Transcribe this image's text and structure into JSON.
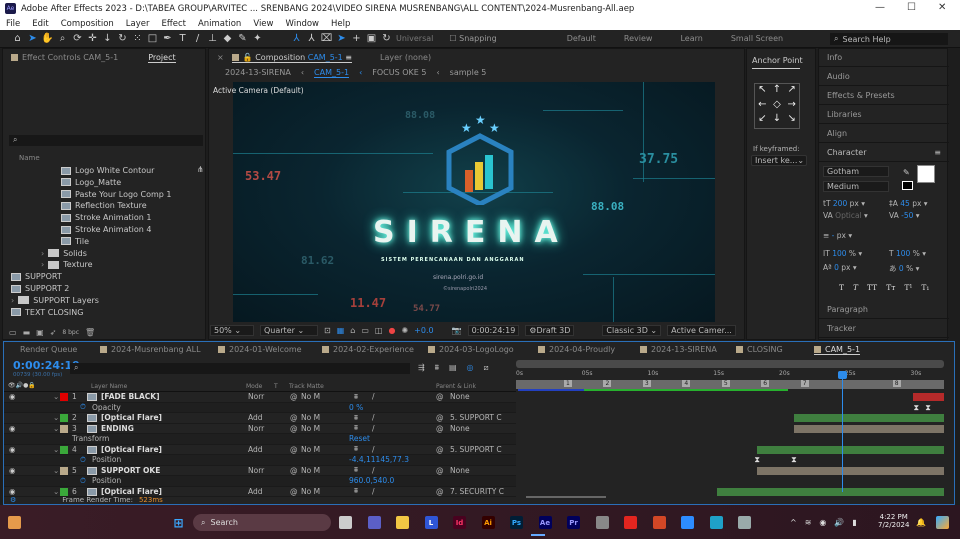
{
  "window": {
    "title": "Adobe After Effects 2023 - D:\\TABEA GROUP\\ARVITEC ... SRENBANG 2024\\VIDEO SIRENA MUSRENBANG\\ALL CONTENT\\2024-Musrenbang-All.aep",
    "app_badge": "Ae"
  },
  "menu": [
    "File",
    "Edit",
    "Composition",
    "Layer",
    "Effect",
    "Animation",
    "View",
    "Window",
    "Help"
  ],
  "toolbar": {
    "universal": "Universal",
    "snapping": "Snapping",
    "workspaces": [
      "Default",
      "Review",
      "Learn",
      "Small Screen"
    ],
    "search_placeholder": "Search Help"
  },
  "left_panel": {
    "tabs": [
      "Effect Controls CAM_5-1",
      "Project"
    ],
    "name_header": "Name",
    "items": [
      {
        "label": "Logo White Contour",
        "type": "comp"
      },
      {
        "label": "Logo_Matte",
        "type": "comp"
      },
      {
        "label": "Paste Your Logo Comp 1",
        "type": "comp"
      },
      {
        "label": "Reflection Texture",
        "type": "comp"
      },
      {
        "label": "Stroke Animation 1",
        "type": "comp"
      },
      {
        "label": "Stroke Animation 4",
        "type": "comp"
      },
      {
        "label": "Tile",
        "type": "comp"
      },
      {
        "label": "Solids",
        "type": "folder"
      },
      {
        "label": "Texture",
        "type": "folder"
      },
      {
        "label": "SUPPORT",
        "type": "comp"
      },
      {
        "label": "SUPPORT 2",
        "type": "comp"
      },
      {
        "label": "SUPPORT Layers",
        "type": "folder"
      },
      {
        "label": "TEXT CLOSING",
        "type": "comp"
      }
    ],
    "bpc": "8 bpc"
  },
  "composition": {
    "tab_prefix": "Composition",
    "tab_name": "CAM_5-1",
    "layer_tab": "Layer  (none)",
    "breadcrumbs": [
      "2024-13-SIRENA",
      "CAM_5-1",
      "FOCUS OKE 5",
      "sample 5"
    ],
    "camera_label": "Active Camera (Default)",
    "viewer": {
      "title": "SIRENA",
      "subtitle": "SISTEM PERENCANAAN DAN ANGGARAN",
      "url": "sirena.polri.go.id",
      "copyright": "©sirenapolri2024",
      "numbers": [
        "53.47",
        "37.75",
        "88.08",
        "81.62",
        "11.47",
        "54.77",
        "88.08"
      ]
    },
    "bottom_bar": {
      "zoom": "50%",
      "resolution": "Quarter",
      "exposure": "+0.0",
      "timecode": "0:00:24:19",
      "draft": "Draft 3D",
      "renderer": "Classic 3D",
      "view": "Active Camer..."
    }
  },
  "anchor_panel": {
    "title": "Anchor Point",
    "if_keyframed": "If keyframed:",
    "mode": "Insert ke..."
  },
  "right_panel": {
    "items": [
      "Info",
      "Audio",
      "Effects & Presets",
      "Libraries",
      "Align"
    ],
    "character": {
      "title": "Character",
      "font": "Gotham",
      "style": "Medium",
      "size": "200",
      "size_unit": "px",
      "leading": "45",
      "leading_unit": "px",
      "kerning": "Optical",
      "tracking": "-50",
      "stroke": "-",
      "stroke_unit": "px",
      "vscale": "100",
      "hscale": "100",
      "pct": "%",
      "baseline": "0",
      "baseline_unit": "px",
      "tsume": "0",
      "fill_color": "#ffffff",
      "styles": [
        "T",
        "T",
        "TT",
        "Tт",
        "T¹",
        "T₁"
      ]
    },
    "bottom": [
      "Paragraph",
      "Tracker"
    ]
  },
  "timeline": {
    "tabs": [
      "Render Queue",
      "2024-Musrenbang ALL",
      "2024-01-Welcome",
      "2024-02-Experience",
      "2024-03-LogoLogo",
      "2024-04-Proudly",
      "2024-13-SIRENA",
      "CLOSING",
      "CAM_5-1"
    ],
    "current_time": "0:00:24:19",
    "frame_info": "00739 (30.00 fps)",
    "headers": {
      "layer_name": "Layer Name",
      "mode": "Mode",
      "t": "T",
      "track_matte": "Track Matte",
      "parent": "Parent & Link"
    },
    "ruler": {
      "labels": [
        "0s",
        "05s",
        "10s",
        "15s",
        "20s",
        "25s",
        "30s"
      ],
      "markers": [
        "1",
        "2",
        "3",
        "4",
        "5",
        "6",
        "7",
        "8"
      ],
      "playhead_seconds": 24.63,
      "duration_seconds": 32
    },
    "rows": [
      {
        "kind": "layer",
        "num": "1",
        "name": "[FADE BLACK]",
        "label_color": "#e00000",
        "mode": "Norr",
        "matte": "No M",
        "parent": "None",
        "bar_color": "#b52a2a",
        "bar_start": 30.0,
        "eye": true
      },
      {
        "kind": "prop",
        "name": "Opacity",
        "value": "0 %",
        "keyframes": [
          30.3,
          31.2
        ]
      },
      {
        "kind": "layer",
        "num": "2",
        "name": "[Optical Flare]",
        "label_color": "#3aa83a",
        "mode": "Add",
        "matte": "No M",
        "parent": "5. SUPPORT C",
        "bar_color": "#3f7f3f",
        "bar_start": 21.0,
        "eye": false
      },
      {
        "kind": "layer",
        "num": "3",
        "name": "ENDING",
        "label_color": "#b9a98a",
        "mode": "Norr",
        "matte": "No M",
        "parent": "None",
        "bar_color": "#7d7466",
        "bar_start": 21.0,
        "eye": true
      },
      {
        "kind": "group",
        "name": "Transform",
        "value": "Reset"
      },
      {
        "kind": "layer",
        "num": "4",
        "name": "[Optical Flare]",
        "label_color": "#3aa83a",
        "mode": "Add",
        "matte": "No M",
        "parent": "5. SUPPORT C",
        "bar_color": "#3f7f3f",
        "bar_start": 18.2,
        "eye": true
      },
      {
        "kind": "prop",
        "name": "Position",
        "value": "-4.4,11145,77.3",
        "keyframes": [
          18.2,
          21.0
        ]
      },
      {
        "kind": "layer",
        "num": "5",
        "name": "SUPPORT OKE",
        "label_color": "#b9a98a",
        "mode": "Norr",
        "matte": "No M",
        "parent": "None",
        "bar_color": "#7d7466",
        "bar_start": 18.2,
        "eye": true
      },
      {
        "kind": "prop",
        "name": "Position",
        "value": "960.0,540.0",
        "keyframes": []
      },
      {
        "kind": "layer",
        "num": "6",
        "name": "[Optical Flare]",
        "label_color": "#3aa83a",
        "mode": "Add",
        "matte": "No M",
        "parent": "7. SECURITY C",
        "bar_color": "#3f7f3f",
        "bar_start": 15.1,
        "eye": true
      }
    ],
    "frame_render_label": "Frame Render Time:",
    "frame_render_value": "523ms"
  },
  "taskbar": {
    "search": "Search",
    "apps": [
      "Files",
      "Teams",
      "Explorer",
      "L",
      "Id",
      "Ai",
      "Ps",
      "Ae",
      "Pr",
      "Tool",
      "Acrobat",
      "PowerPoint",
      "Zoom",
      "Edge",
      "Calculator"
    ],
    "time": "4:22 PM",
    "date": "7/2/2024"
  }
}
